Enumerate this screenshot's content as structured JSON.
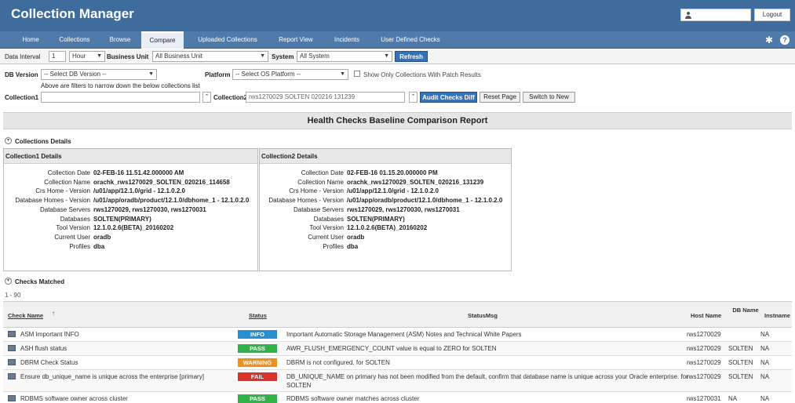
{
  "app": {
    "title": "Collection Manager",
    "logout_label": "Logout"
  },
  "nav": {
    "tabs": [
      {
        "label": "Home"
      },
      {
        "label": "Collections"
      },
      {
        "label": "Browse"
      },
      {
        "label": "Compare",
        "active": true
      },
      {
        "label": "Uploaded Collections"
      },
      {
        "label": "Report View"
      },
      {
        "label": "Incidents"
      },
      {
        "label": "User Defined Checks"
      }
    ]
  },
  "filters": {
    "data_interval_label": "Data Interval",
    "data_interval_value": "1",
    "interval_unit": "Hour",
    "business_unit_label": "Business Unit",
    "business_unit_value": "All Business Unit",
    "system_label": "System",
    "system_value": "All System",
    "refresh_label": "Refresh"
  },
  "compare": {
    "db_version_label": "DB Version",
    "db_version_value": "-- Select DB Version --",
    "platform_label": "Platform",
    "platform_value": "-- Select OS Platform --",
    "patch_results_label": "Show Only Collections With Patch Results",
    "hint": "Above are filters to narrow down the below collections list",
    "collection1_label": "Collection1",
    "collection1_value": "",
    "collection2_label": "Collection2",
    "collection2_value": "rws1270029 SOLTEN 020216 131239",
    "audit_button": "Audit Checks Diff",
    "reset_button": "Reset Page",
    "switch_button": "Switch to New"
  },
  "report": {
    "title": "Health Checks Baseline Comparison Report"
  },
  "details": {
    "section_title": "Collections Details",
    "field_labels": [
      "Collection Date",
      "Collection Name",
      "Crs Home - Version",
      "Database Homes - Version",
      "Database Servers",
      "Databases",
      "Tool Version",
      "Current User",
      "Profiles"
    ],
    "collection1": {
      "heading": "Collection1 Details",
      "values": [
        "02-FEB-16 11.51.42.000000 AM",
        "orachk_rws1270029_SOLTEN_020216_114658",
        "/u01/app/12.1.0/grid - 12.1.0.2.0",
        "/u01/app/oradb/product/12.1.0/dbhome_1 - 12.1.0.2.0",
        "rws1270029, rws1270030, rws1270031",
        "SOLTEN(PRIMARY)",
        "12.1.0.2.6(BETA)_20160202",
        "oradb",
        "dba"
      ]
    },
    "collection2": {
      "heading": "Collection2 Details",
      "values": [
        "02-FEB-16 01.15.20.000000 PM",
        "orachk_rws1270029_SOLTEN_020216_131239",
        "/u01/app/12.1.0/grid - 12.1.0.2.0",
        "/u01/app/oradb/product/12.1.0/dbhome_1 - 12.1.0.2.0",
        "rws1270029, rws1270030, rws1270031",
        "SOLTEN(PRIMARY)",
        "12.1.0.2.6(BETA)_20160202",
        "oradb",
        "dba"
      ]
    }
  },
  "checks": {
    "section_title": "Checks Matched",
    "range": "1 - 90",
    "columns": {
      "check_name": "Check Name",
      "status": "Status",
      "status_msg": "StatusMsg",
      "host_name": "Host Name",
      "db_name": "DB Name",
      "inst_name": "Instname"
    },
    "rows": [
      {
        "name": "ASM Important INFO",
        "status": "INFO",
        "kind": "info",
        "msg": "Important Automatic Storage Management (ASM) Notes and Technical White Papers",
        "msg2": "",
        "host": "rws1270029",
        "db": "",
        "inst": "NA"
      },
      {
        "name": "ASH flush status",
        "status": "PASS",
        "kind": "pass",
        "msg": "AWR_FLUSH_EMERGENCY_COUNT value is equal to ZERO for SOLTEN",
        "msg2": "",
        "host": "rws1270029",
        "db": "SOLTEN",
        "inst": "NA"
      },
      {
        "name": "DBRM Check Status",
        "status": "WARNING",
        "kind": "warning",
        "msg": "DBRM is not configured. for SOLTEN",
        "msg2": "",
        "host": "rws1270029",
        "db": "SOLTEN",
        "inst": "NA"
      },
      {
        "name": "Ensure db_unique_name is unique across the enterprise [primary]",
        "status": "FAIL",
        "kind": "fail",
        "msg": "DB_UNIQUE_NAME on primary has not been modified from the default, confirm that database name is unique across your Oracle enterprise. for",
        "msg2": "SOLTEN",
        "host": "rws1270029",
        "db": "SOLTEN",
        "inst": "NA"
      },
      {
        "name": "RDBMS software owner across cluster",
        "status": "PASS",
        "kind": "pass",
        "msg": "RDBMS software owner matches across cluster",
        "msg2": "",
        "host": "rws1270031",
        "db": "NA",
        "inst": "NA"
      }
    ]
  }
}
